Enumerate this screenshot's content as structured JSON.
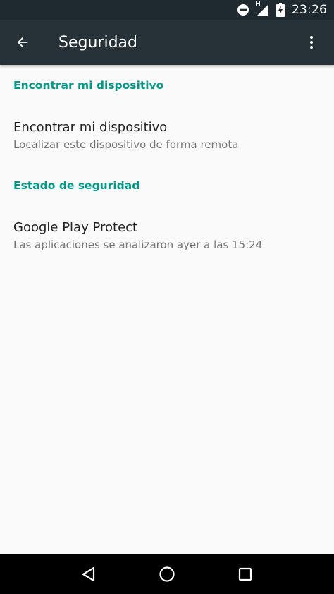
{
  "status_bar": {
    "time": "23:26",
    "icons": [
      "do-not-disturb-icon",
      "signal-h-icon",
      "battery-charging-icon"
    ],
    "network_label": "H"
  },
  "app_bar": {
    "title": "Seguridad",
    "back_icon": "arrow-back-icon",
    "overflow_icon": "more-vert-icon",
    "background": "#263238"
  },
  "sections": [
    {
      "header": "Encontrar mi dispositivo",
      "items": [
        {
          "title": "Encontrar mi dispositivo",
          "summary": "Localizar este dispositivo de forma remota"
        }
      ]
    },
    {
      "header": "Estado de seguridad",
      "items": [
        {
          "title": "Google Play Protect",
          "summary": "Las aplicaciones se analizaron ayer a las 15:24"
        }
      ]
    }
  ],
  "nav_bar": {
    "buttons": [
      "back-triangle-icon",
      "home-circle-icon",
      "recents-square-icon"
    ]
  },
  "colors": {
    "accent": "#009688",
    "background": "#fafafa",
    "status_bar": "#1f2a30"
  }
}
